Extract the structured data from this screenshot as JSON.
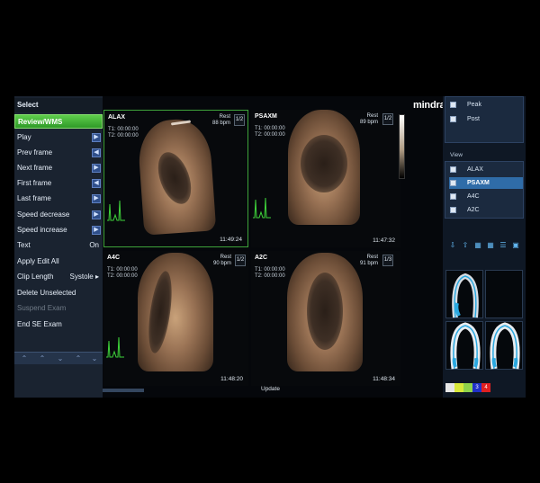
{
  "menu": {
    "title": "Select",
    "items": [
      {
        "label": "Review/WMS",
        "state": "active"
      },
      {
        "label": "Play",
        "arrow": "▶"
      },
      {
        "label": "Prev frame",
        "arrow": "◀"
      },
      {
        "label": "Next frame",
        "arrow": "▶"
      },
      {
        "label": "First frame",
        "arrow": "◀"
      },
      {
        "label": "Last frame",
        "arrow": "▶"
      },
      {
        "label": "Speed decrease",
        "arrow": "▶"
      },
      {
        "label": "Speed increase",
        "arrow": "▶"
      },
      {
        "label": "Text",
        "value": "On"
      },
      {
        "label": "Apply Edit All"
      },
      {
        "label": "Clip Length",
        "value": "Systole ▸"
      },
      {
        "label": "Delete Unselected"
      },
      {
        "label": "Suspend Exam",
        "state": "disabled"
      },
      {
        "label": "End SE Exam"
      }
    ]
  },
  "brand": "mindray",
  "quads": [
    {
      "name": "ALAX",
      "t1": "T1: 00:00:00",
      "t2": "T2: 00:00:00",
      "rest": "Rest",
      "bpm": "88 bpm",
      "frame": "1/2",
      "time": "11:49:24"
    },
    {
      "name": "PSAXM",
      "t1": "T1: 00:00:00",
      "t2": "T2: 00:00:00",
      "rest": "Rest",
      "bpm": "89 bpm",
      "frame": "1/2",
      "time": "11:47:32"
    },
    {
      "name": "A4C",
      "t1": "T1: 00:00:00",
      "t2": "T2: 00:00:00",
      "rest": "Rest",
      "bpm": "90 bpm",
      "frame": "1/2",
      "time": "11:48:20"
    },
    {
      "name": "A2C",
      "t1": "T1: 00:00:00",
      "t2": "T2: 00:00:00",
      "rest": "Rest",
      "bpm": "91 bpm",
      "frame": "1/3",
      "time": "11:48:34"
    }
  ],
  "update_label": "Update",
  "right_panel": {
    "stages": [
      "Peak",
      "Post"
    ],
    "view_title": "View",
    "views": [
      "ALAX",
      "PSAXM",
      "A4C",
      "A2C"
    ],
    "selected_view": "PSAXM",
    "color_strip": [
      {
        "color": "#e6e6e6",
        "label": ""
      },
      {
        "color": "#d8e83a",
        "label": ""
      },
      {
        "color": "#8fd34a",
        "label": ""
      },
      {
        "color": "#2030c8",
        "label": "3"
      },
      {
        "color": "#e02020",
        "label": "4"
      }
    ]
  }
}
